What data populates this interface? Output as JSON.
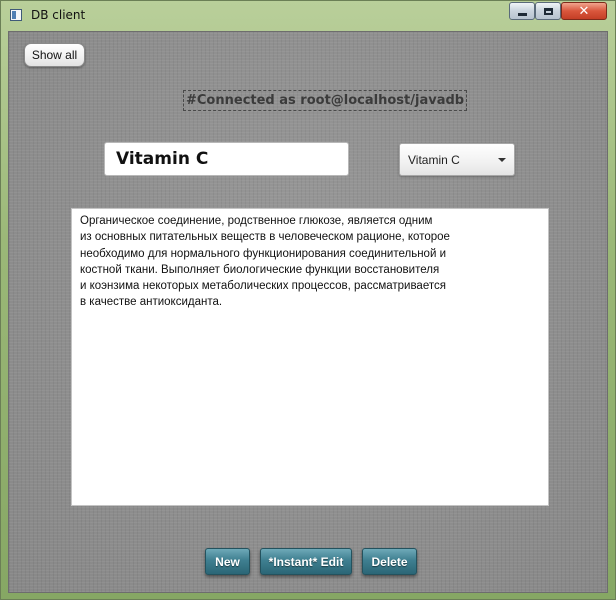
{
  "window": {
    "title": "DB client",
    "icon": "app-window-icon",
    "controls": {
      "minimize": "minimize-icon",
      "maximize": "maximize-icon",
      "close": "close-icon",
      "close_glyph": "✕"
    }
  },
  "toolbar": {
    "show_all_label": "Show all"
  },
  "status": {
    "text": "#Connected as root@localhost/javadb"
  },
  "form": {
    "name_value": "Vitamin C",
    "selector_value": "Vitamin C",
    "description": "Органическое соединение, родственное глюкозе, является одним\nиз основных питательных веществ в человеческом рационе, которое\nнеобходимо для нормального функционирования соединительной и\nкостной ткани. Выполняет биологические функции восстановителя\nи коэнзима некоторых метаболических процессов, рассматривается\nв качестве антиоксиданта."
  },
  "actions": {
    "new_label": "New",
    "edit_label": "*Instant* Edit",
    "delete_label": "Delete"
  },
  "colors": {
    "action_button": "#3f7f90",
    "background_fabric": "#8e8e8e",
    "close_button": "#d9563c"
  }
}
